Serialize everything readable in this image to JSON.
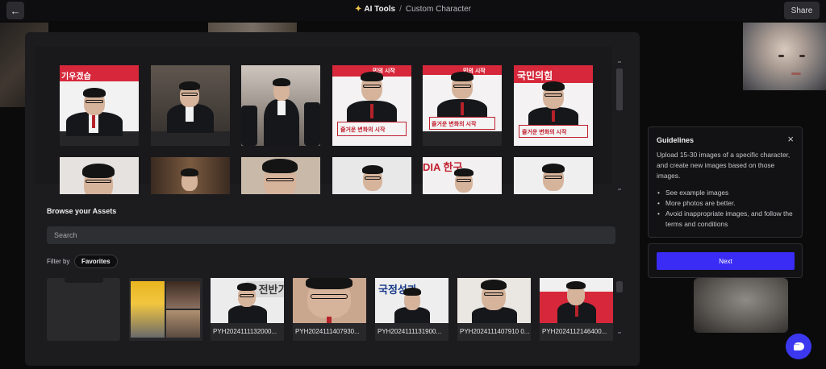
{
  "header": {
    "back_label": "←",
    "tool_icon": "magic-wand-icon",
    "tool_label": "AI Tools",
    "separator": "/",
    "page_label": "Custom Character",
    "share_label": "Share"
  },
  "upload_grid": {
    "row1": [
      {
        "banner": "기우겠습"
      },
      {
        "banner": ""
      },
      {
        "banner": ""
      },
      {
        "banner": "민의 시작",
        "podium": "즐거운 변화의 시작"
      },
      {
        "banner": "민의 시작",
        "podium": "즐거운 변화의 시작"
      },
      {
        "banner": "국민의힘",
        "podium": "즐거운 변화의 시작"
      }
    ],
    "row2": [
      {
        "banner": ""
      },
      {
        "banner": ""
      },
      {
        "banner": ""
      },
      {
        "banner": ""
      },
      {
        "banner": "DIA 한구"
      },
      {
        "banner": ""
      }
    ]
  },
  "assets": {
    "section_title": "Browse your Assets",
    "search_placeholder": "Search",
    "filter_label": "Filter by",
    "filter_chip": "Favorites",
    "items": [
      {
        "caption": "PYH2024111132000..."
      },
      {
        "caption": "PYH2024111407930..."
      },
      {
        "caption": "PYH2024111131900..."
      },
      {
        "caption": "PYH2024111407910 0..."
      },
      {
        "caption": "PYH2024112146400..."
      }
    ],
    "banner_texts": [
      "동 전반기",
      "",
      "국정성과",
      "",
      ""
    ]
  },
  "guidelines": {
    "title": "Guidelines",
    "close_icon": "close-icon",
    "description": "Upload 15-30 images of a specific character, and create new images based on those images.",
    "bullets": [
      "See example images",
      "More photos are better.",
      "Avoid inappropriate images, and follow the terms and conditions"
    ],
    "next_label": "Next"
  },
  "colors": {
    "accent": "#3a2cf5",
    "chat": "#3b38f0",
    "banner_red": "#d6283a"
  }
}
